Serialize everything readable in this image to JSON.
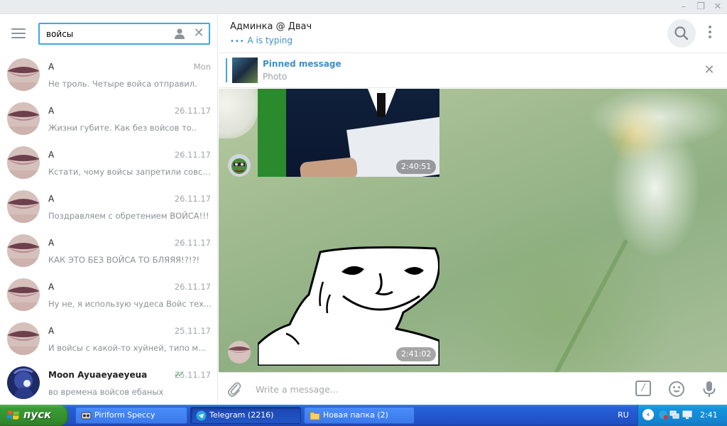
{
  "window": {
    "minimize": "–",
    "maximize": "❐",
    "close": "✕"
  },
  "search": {
    "value": "войсы"
  },
  "chats": [
    {
      "name": "A",
      "date": "Mon",
      "preview": "Не троль. Четыре войса отправил."
    },
    {
      "name": "A",
      "date": "26.11.17",
      "preview": "Жизни губите. Как без войсов то.."
    },
    {
      "name": "A",
      "date": "26.11.17",
      "preview": "Кстати, чому войсы запретили совсем?"
    },
    {
      "name": "A",
      "date": "26.11.17",
      "preview": "Поздравляем с обретением ВОЙСА!!!"
    },
    {
      "name": "A",
      "date": "26.11.17",
      "preview": "КАК ЭТО БЕЗ ВОЙСА ТО БЛЯЯЯ!?!?!"
    },
    {
      "name": "A",
      "date": "26.11.17",
      "preview": "Ну не, я использую чудеса Войс тех..."
    },
    {
      "name": "A",
      "date": "25.11.17",
      "preview": "И войсы с какой-то хуйней, типо м..."
    },
    {
      "name": "Moon Ayuaeyaeyeua",
      "date": "25.11.17",
      "preview": "во времена войсов ебаных",
      "check": "✓✓"
    }
  ],
  "header": {
    "title": "Админка @ Двач",
    "typing_dots": "•••",
    "typing_text": "A is typing"
  },
  "pinned": {
    "title": "Pinned message",
    "subtitle": "Photo",
    "close": "✕"
  },
  "messages": [
    {
      "type": "photo",
      "time": "2:40:51"
    },
    {
      "type": "sticker",
      "time": "2:41:02"
    }
  ],
  "composer": {
    "placeholder": "Write a message...",
    "command_glyph": "/"
  },
  "taskbar": {
    "start_label": "пуск",
    "tasks": [
      {
        "label": "Piriform Speccy",
        "icon": "speccy-icon"
      },
      {
        "label": "Telegram (2216)",
        "icon": "telegram-icon",
        "active": true
      },
      {
        "label": "Новая папка (2)",
        "icon": "folder-icon"
      }
    ],
    "language": "RU",
    "tray_arrow": "‹",
    "clock": "2:41"
  }
}
